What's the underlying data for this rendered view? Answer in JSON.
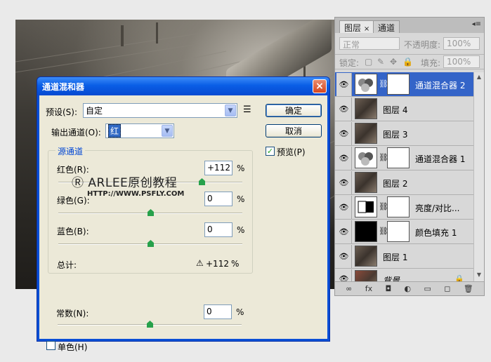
{
  "dialog": {
    "title": "通道混和器",
    "close": "×",
    "preset_label": "预设(S):",
    "preset_value": "自定",
    "preset_menu": "☰",
    "output_label": "输出通道(O):",
    "output_value": "红",
    "ok": "确定",
    "cancel": "取消",
    "preview_label": "预览(P)",
    "preview_checked": "✓",
    "source_group": "源通道",
    "red_label": "红色(R):",
    "red_value": "+112",
    "green_label": "绿色(G):",
    "green_value": "0",
    "blue_label": "蓝色(B):",
    "blue_value": "0",
    "percent": "%",
    "total_label": "总计:",
    "total_value": "+112",
    "warn": "⚠",
    "constant_label": "常数(N):",
    "constant_value": "0",
    "mono_label": "单色(H)"
  },
  "watermark": {
    "line1": "Ⓡ ARLEE原创教程",
    "line2": "HTTP://WWW.PSFLY.COM"
  },
  "layers_panel": {
    "tabs": [
      "图层",
      "通道"
    ],
    "tab_close": "×",
    "menu": "◂≡",
    "blend_mode": "正常",
    "opacity_label": "不透明度:",
    "opacity_value": "100%",
    "lock_label": "锁定:",
    "fill_label": "填充:",
    "fill_value": "100%",
    "layers": [
      {
        "name": "通道混合器 2"
      },
      {
        "name": "图层 4"
      },
      {
        "name": "图层 3"
      },
      {
        "name": "通道混合器 1"
      },
      {
        "name": "图层 2"
      },
      {
        "name": "亮度/对比..."
      },
      {
        "name": "颜色填充 1"
      },
      {
        "name": "图层 1"
      },
      {
        "name": "背景"
      }
    ],
    "bottom_icons": [
      "∞",
      "fx",
      "◘",
      "◐",
      "▭",
      "◻",
      "🗑"
    ]
  }
}
